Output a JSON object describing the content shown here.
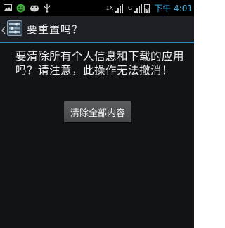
{
  "status_bar": {
    "network_1": "1X",
    "network_2": "G",
    "time": "下午 4:01",
    "left_icons": [
      "gallery-notification-icon",
      "android-notification-icon",
      "usb-debug-icon",
      "usb-icon"
    ],
    "right_icons": [
      "signal-1x-icon",
      "signal-g-icon",
      "battery-charging-icon"
    ]
  },
  "action_bar": {
    "title": "要重置吗？",
    "app_icon": "settings-app-icon"
  },
  "content": {
    "message": "要清除所有个人信息和下载的应用吗？请注意，此操作无法撤消！",
    "button_label": "清除全部内容"
  },
  "colors": {
    "background": "#111316",
    "accent": "#34b5e5",
    "action_bar_divider": "#2e8fbf",
    "button": "#505256"
  }
}
